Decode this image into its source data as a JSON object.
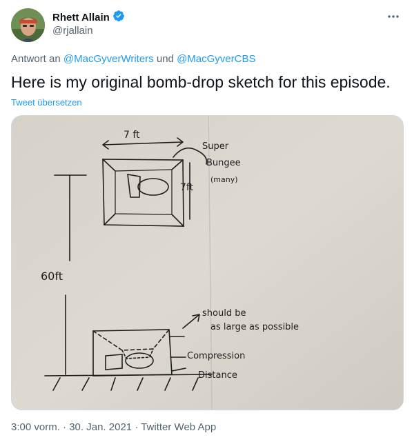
{
  "author": {
    "name": "Rhett Allain",
    "handle": "@rjallain",
    "verified": true
  },
  "reply": {
    "prefix": "Antwort an",
    "mention1": "@MacGyverWriters",
    "conjunction": "und",
    "mention2": "@MacGyverCBS"
  },
  "tweet": {
    "text": "Here is my original bomb-drop sketch for this episode.",
    "translate_label": "Tweet übersetzen"
  },
  "sketch": {
    "width_label": "7 ft",
    "height_label": "7ft",
    "bungee_label_1": "Super",
    "bungee_label_2": "Bungee",
    "bungee_label_3": "(many)",
    "drop_label": "60ft",
    "note_line1": "should be",
    "note_line2": "as large as possible",
    "compression_label": "Compression",
    "distance_label": "Distance"
  },
  "meta": {
    "time": "3:00 vorm.",
    "date": "30. Jan. 2021",
    "source": "Twitter Web App"
  },
  "colors": {
    "link": "#1d9bf0",
    "secondary_text": "#536471",
    "primary_text": "#0f1419",
    "paper": "#d9d5cd",
    "ink": "#1d1d1d"
  }
}
